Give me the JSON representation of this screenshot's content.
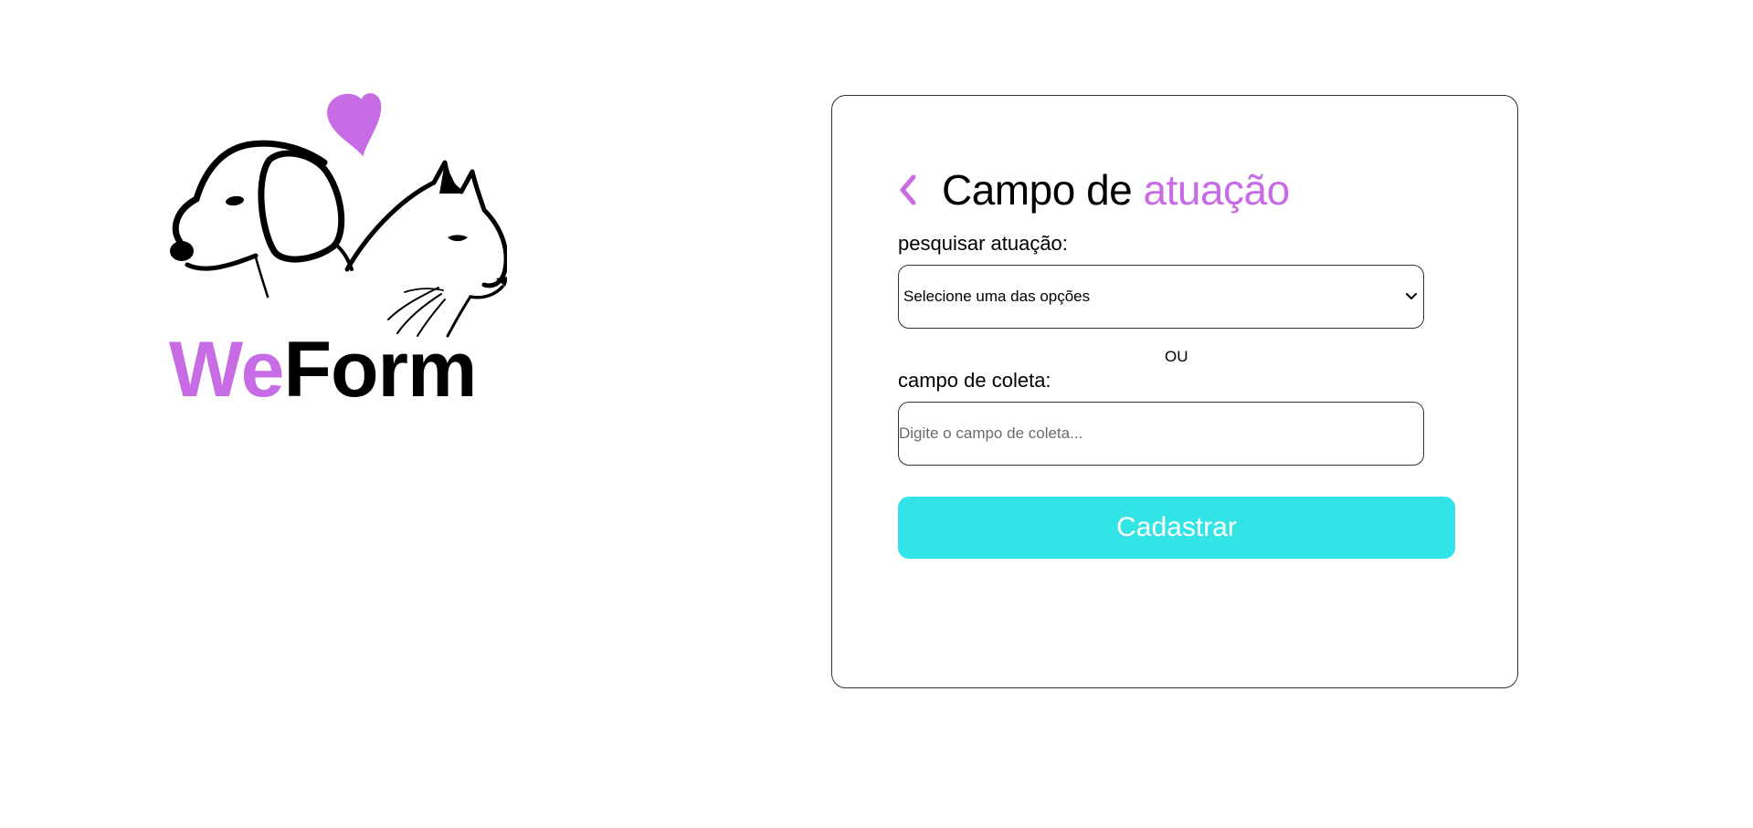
{
  "brand": {
    "name_part1": "We",
    "name_part2": "Form",
    "logo_icon": "dog-cat-heart-illustration",
    "accent_color": "#c86ce6"
  },
  "form": {
    "back_icon": "chevron-left-icon",
    "title_part1": "Campo de ",
    "title_part2": "atuação",
    "search_label": "pesquisar atuação:",
    "select_value": "Selecione uma das opções",
    "or_text": "OU",
    "field_label": "campo de coleta:",
    "field_placeholder": "Digite o campo de coleta...",
    "submit_label": "Cadastrar",
    "submit_color": "#33e4e6"
  }
}
